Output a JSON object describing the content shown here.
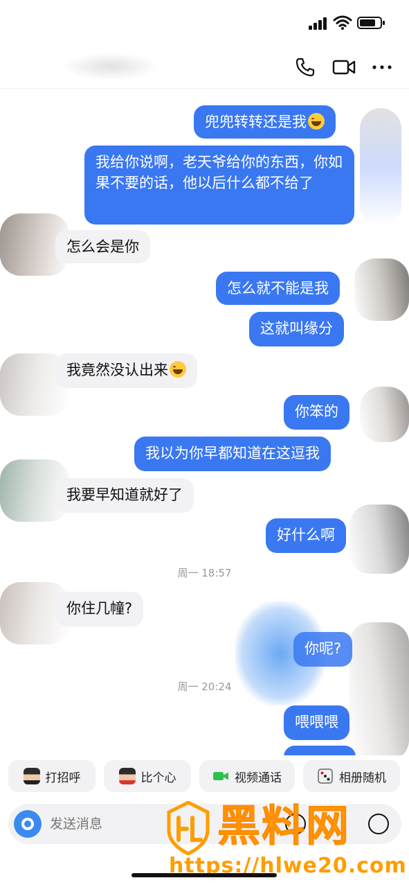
{
  "status_bar": {
    "signal_icon": "signal-bars-icon",
    "wifi_icon": "wifi-icon",
    "battery_icon": "battery-icon"
  },
  "header": {
    "icons": [
      "phone-icon",
      "video-camera-icon",
      "more-dots-icon"
    ]
  },
  "messages": [
    {
      "dir": "out",
      "text": "兜兜转转还是我",
      "emoji": "laughing-tears-emoji"
    },
    {
      "dir": "out",
      "text": "我给你说啊，老天爷给你的东西，你如果不要的话，他以后什么都不给了"
    },
    {
      "dir": "in",
      "text": "怎么会是你"
    },
    {
      "dir": "out",
      "text": "怎么就不能是我"
    },
    {
      "dir": "out",
      "text": "这就叫缘分"
    },
    {
      "dir": "in",
      "text": "我竟然没认出来",
      "emoji": "rolling-laughing-emoji"
    },
    {
      "dir": "out",
      "text": "你笨的"
    },
    {
      "dir": "out",
      "text": "我以为你早都知道在这逗我"
    },
    {
      "dir": "in",
      "text": "我要早知道就好了"
    },
    {
      "dir": "out",
      "text": "好什么啊"
    },
    {
      "dir": "time",
      "text": "周一 18:57"
    },
    {
      "dir": "in",
      "text": "你住几幢?"
    },
    {
      "dir": "out",
      "text": "你呢?"
    },
    {
      "dir": "time",
      "text": "周一 20:24"
    },
    {
      "dir": "out",
      "text": "喂喂喂"
    }
  ],
  "quick_actions": [
    {
      "label": "打招呼",
      "icon": "character-wave-icon"
    },
    {
      "label": "比个心",
      "icon": "character-heart-icon"
    },
    {
      "label": "视频通话",
      "icon": "video-call-icon",
      "color": "#2fbf4f"
    },
    {
      "label": "相册随机",
      "icon": "dice-icon"
    }
  ],
  "input": {
    "placeholder": "发送消息",
    "camera_icon": "camera-icon"
  },
  "watermark": {
    "title": "黑料网",
    "url": "https://hlwe20.com",
    "color": "#ff9d00"
  },
  "colors": {
    "outgoing_bubble": "#3a78f2",
    "incoming_bubble": "#f2f2f4"
  }
}
